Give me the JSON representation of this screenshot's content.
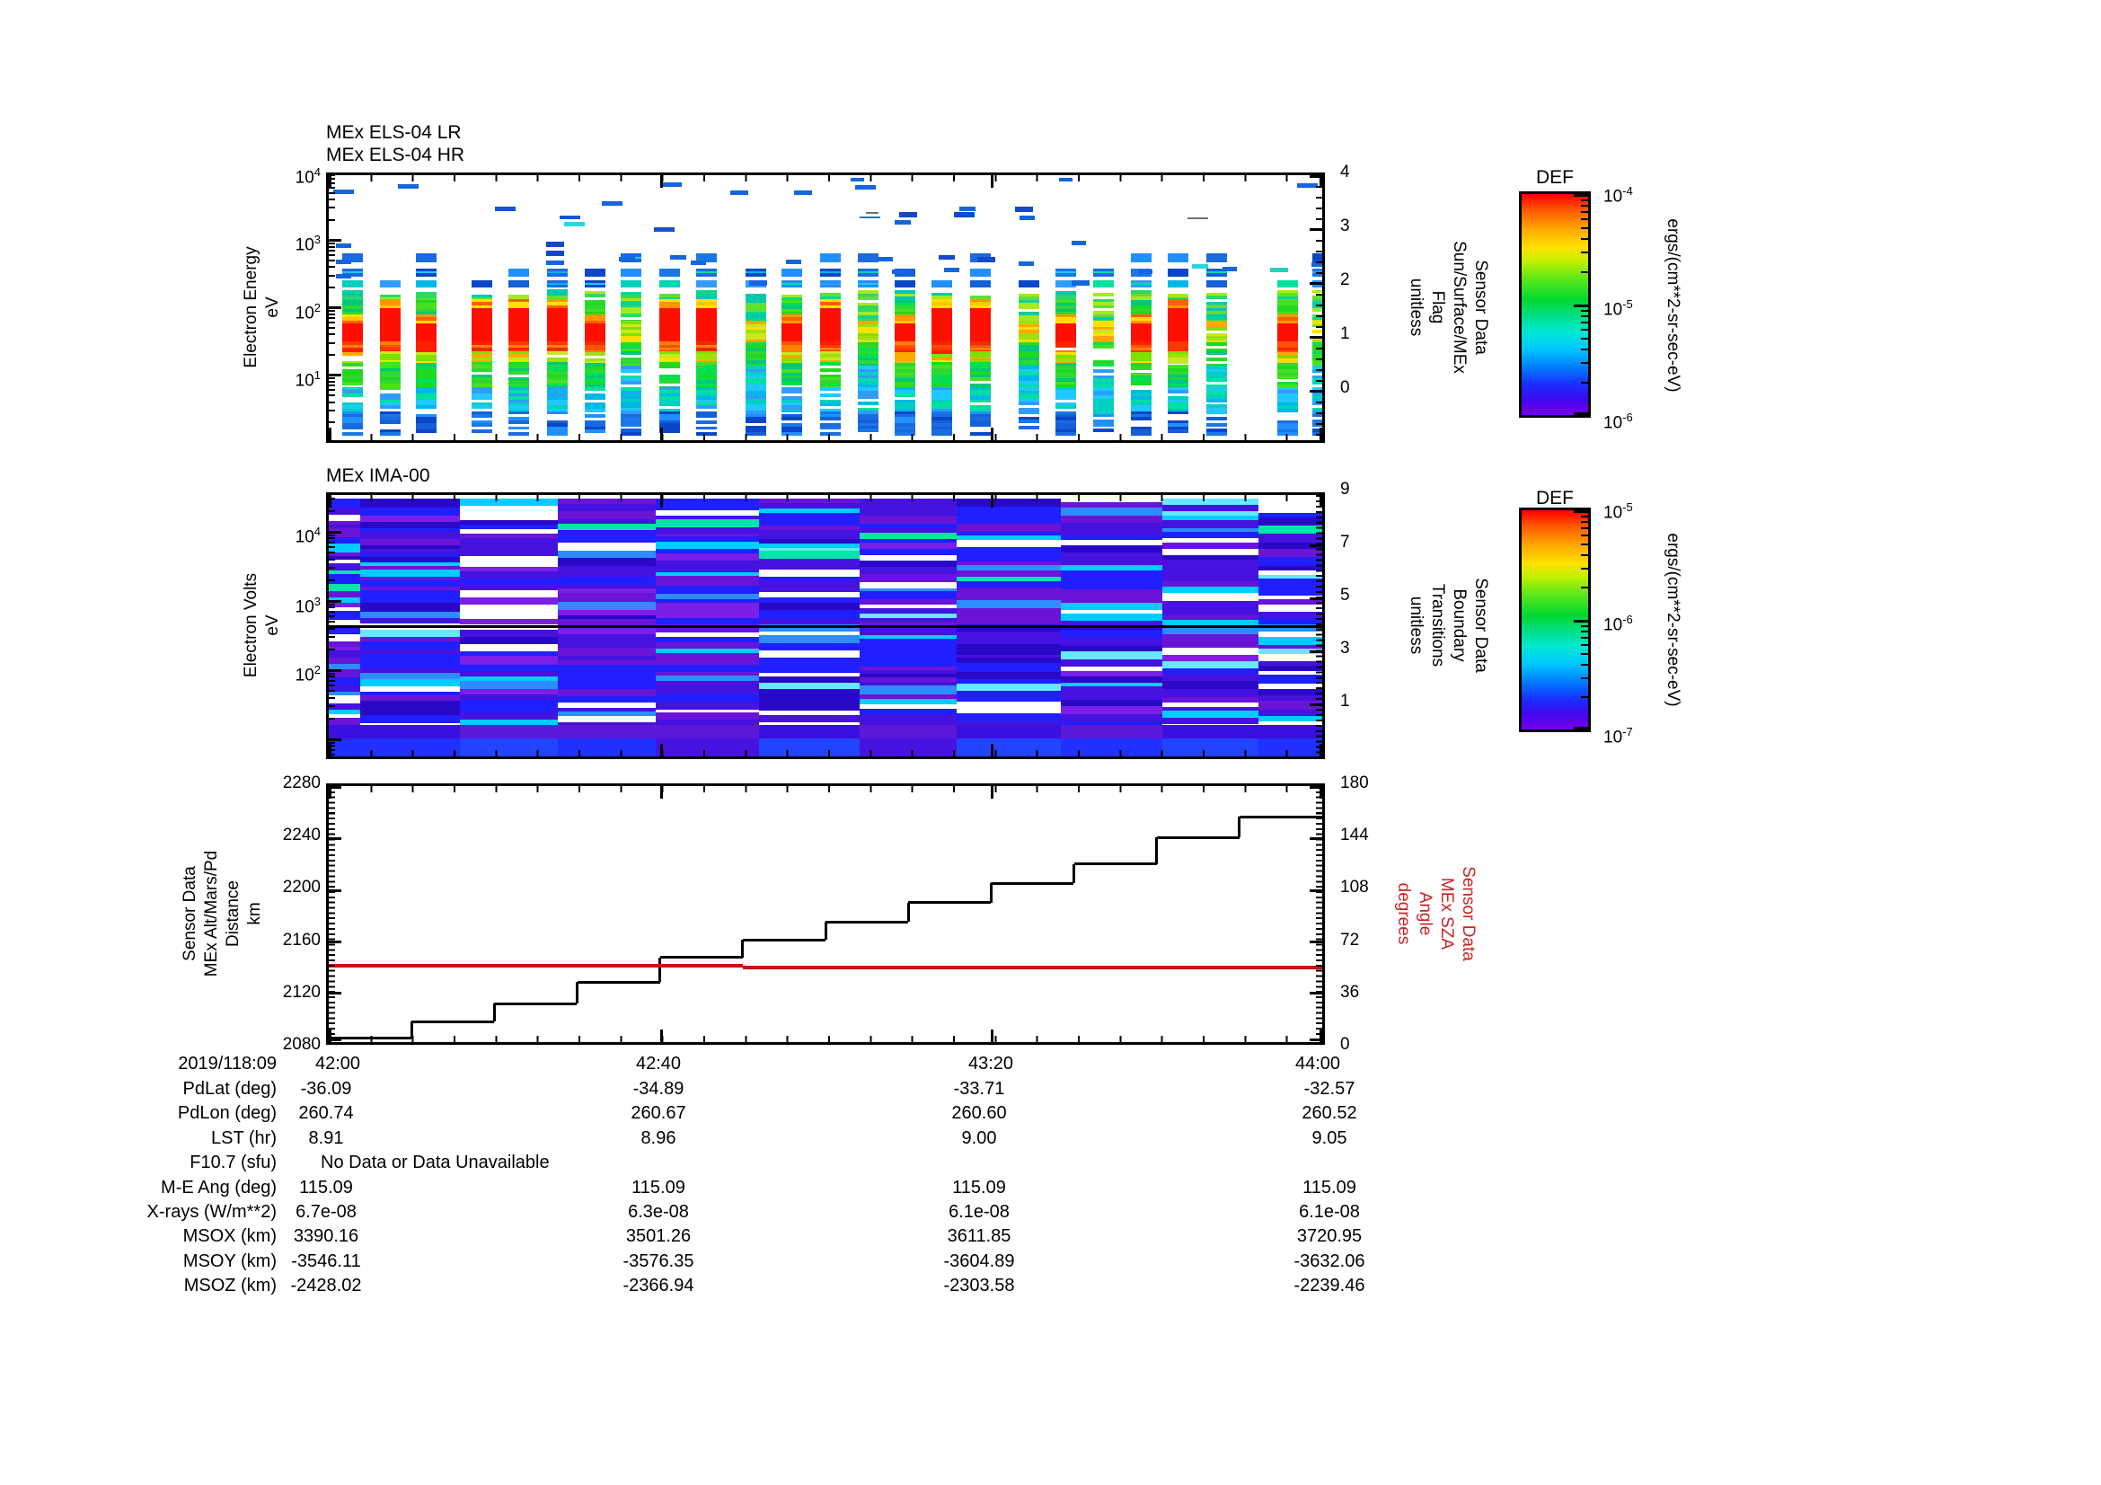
{
  "page": {
    "background": "#ffffff"
  },
  "panels": {
    "els": {
      "title_lr": "MEx ELS-04 LR",
      "title_hr": "MEx ELS-04 HR",
      "ylabel_lines": [
        "Electron Energy",
        "eV"
      ],
      "yticks": [
        "10^4",
        "10^3",
        "10^2",
        "10^1"
      ],
      "right_axis": {
        "ticks": [
          "4",
          "3",
          "2",
          "1",
          "0"
        ],
        "label_lines": [
          "Sensor Data",
          "Sun/Surface/MEx",
          "Flag",
          "unitless"
        ]
      }
    },
    "ima": {
      "title": "MEx IMA-00",
      "ylabel_lines": [
        "Electron Volts",
        "eV"
      ],
      "yticks": [
        "10^4",
        "10^3",
        "10^2"
      ],
      "right_axis": {
        "ticks": [
          "9",
          "7",
          "5",
          "3",
          "1"
        ],
        "label_lines": [
          "Sensor Data",
          "Boundary",
          "Transitions",
          "unitless"
        ]
      },
      "divider_y": 0.498
    },
    "line": {
      "left_axis": {
        "ticks": [
          "2280",
          "2240",
          "2200",
          "2160",
          "2120",
          "2080"
        ],
        "label_lines": [
          "Sensor Data",
          "MEx Alt/Mars/Pd",
          "Distance",
          "km"
        ]
      },
      "right_axis": {
        "ticks": [
          "180",
          "144",
          "108",
          "72",
          "36",
          "0"
        ],
        "label_lines": [
          "Sensor Data",
          "MEx SZA",
          "Angle",
          "degrees"
        ],
        "color": "#cc2222"
      },
      "xticks": [
        "42:00",
        "42:40",
        "43:20",
        "44:00"
      ]
    }
  },
  "colorbars": [
    {
      "title": "DEF",
      "ticks": [
        "10^-4",
        "10^-5",
        "10^-6"
      ],
      "units": "ergs/(cm**2-sr-sec-eV)"
    },
    {
      "title": "DEF",
      "ticks": [
        "10^-5",
        "10^-6",
        "10^-7"
      ],
      "units": "ergs/(cm**2-sr-sec-eV)"
    }
  ],
  "table": {
    "date_label": "2019/118:09",
    "times": [
      "42:00",
      "42:40",
      "43:20",
      "44:00"
    ],
    "no_data_text": "No Data or Data Unavailable",
    "rows": [
      {
        "label": "PdLat (deg)",
        "values": [
          "-36.09",
          "-34.89",
          "-33.71",
          "-32.57"
        ]
      },
      {
        "label": "PdLon (deg)",
        "values": [
          "260.74",
          "260.67",
          "260.60",
          "260.52"
        ]
      },
      {
        "label": "LST (hr)",
        "values": [
          "8.91",
          "8.96",
          "9.00",
          "9.05"
        ]
      },
      {
        "label": "F10.7 (sfu)",
        "values": [
          "",
          "",
          "",
          ""
        ],
        "no_data": true
      },
      {
        "label": "M-E Ang (deg)",
        "values": [
          "115.09",
          "115.09",
          "115.09",
          "115.09"
        ]
      },
      {
        "label": "X-rays (W/m**2)",
        "values": [
          "6.7e-08",
          "6.3e-08",
          "6.1e-08",
          "6.1e-08"
        ]
      },
      {
        "label": "MSOX (km)",
        "values": [
          "3390.16",
          "3501.26",
          "3611.85",
          "3720.95"
        ]
      },
      {
        "label": "MSOY (km)",
        "values": [
          "-3546.11",
          "-3576.35",
          "-3604.89",
          "-3632.06"
        ]
      },
      {
        "label": "MSOZ (km)",
        "values": [
          "-2428.02",
          "-2366.94",
          "-2303.58",
          "-2239.46"
        ]
      }
    ]
  },
  "chart_data": [
    {
      "type": "heatmap",
      "title": "MEx ELS-04 LR / MEx ELS-04 HR",
      "xlabel": "time (2019/118 09:42:00 - 09:44:00)",
      "ylabel": "Electron Energy (eV)",
      "ylim": [
        1,
        10000
      ],
      "yscale": "log",
      "right_axis": {
        "label": "Sensor Data Sun/Surface/MEx Flag (unitless)",
        "ylim": [
          -1,
          4
        ]
      },
      "zlabel": "DEF ergs/(cm**2-sr-sec-eV)",
      "zlim": [
        1e-06,
        0.0001
      ],
      "description": "Burst columns ~30-150 eV reaching ~1e-4 (red), banded green/cyan/blue flux 2-200 eV, sparse blue points 200-8000 eV"
    },
    {
      "type": "heatmap",
      "title": "MEx IMA-00",
      "ylabel": "Electron Volts (eV)",
      "ylim": [
        5,
        40000
      ],
      "yscale": "log",
      "right_axis": {
        "label": "Sensor Data Boundary Transitions (unitless)",
        "ylim": [
          -1,
          9
        ]
      },
      "zlabel": "DEF ergs/(cm**2-sr-sec-eV)",
      "zlim": [
        1e-07,
        1e-05
      ],
      "description": "Dense blue/violet striped mosaic with cyan rows and white gaps; solid black trace across ~460 eV"
    },
    {
      "type": "line",
      "x_axis": {
        "ticks": [
          "42:00",
          "42:40",
          "43:20",
          "44:00"
        ],
        "minutes_span": 120,
        "date": "2019/118:09"
      },
      "left_ylim": [
        2080,
        2280
      ],
      "right_ylim": [
        0,
        180
      ],
      "series": [
        {
          "name": "MEx Alt/Mars/Pd Distance (km)",
          "color": "#000000",
          "style": "step",
          "t_min": [
            0,
            10,
            20,
            30,
            40,
            50,
            60,
            70,
            80,
            90,
            100,
            110,
            120
          ],
          "alt_km": [
            2083,
            2096,
            2110,
            2127,
            2146,
            2160,
            2174,
            2189,
            2204,
            2219,
            2240,
            2256
          ]
        },
        {
          "name": "MEx SZA Angle (degrees)",
          "color": "#cc1111",
          "style": "step",
          "t_min": [
            0,
            50,
            120
          ],
          "sza_deg": [
            54.0,
            52.2
          ]
        }
      ]
    }
  ],
  "texture": {
    "els_bar_width": 0.0207,
    "els_bars": [
      {
        "x": 0.024,
        "p": "M",
        "s": 1
      },
      {
        "x": 0.062,
        "p": "R",
        "s": 2
      },
      {
        "x": 0.098,
        "p": "M",
        "s": 3
      },
      {
        "x": 0.153,
        "p": "R",
        "s": 4
      },
      {
        "x": 0.19,
        "p": "R",
        "s": 5
      },
      {
        "x": 0.229,
        "p": "R",
        "s": 6
      },
      {
        "x": 0.267,
        "p": "M",
        "s": 7
      },
      {
        "x": 0.303,
        "p": "G",
        "s": 8
      },
      {
        "x": 0.341,
        "p": "R",
        "s": 9
      },
      {
        "x": 0.378,
        "p": "R",
        "s": 10
      },
      {
        "x": 0.428,
        "p": "G",
        "s": 11
      },
      {
        "x": 0.464,
        "p": "M",
        "s": 12
      },
      {
        "x": 0.502,
        "p": "R",
        "s": 13
      },
      {
        "x": 0.54,
        "p": "G",
        "s": 14
      },
      {
        "x": 0.577,
        "p": "M",
        "s": 15
      },
      {
        "x": 0.614,
        "p": "R",
        "s": 16
      },
      {
        "x": 0.652,
        "p": "R",
        "s": 17
      },
      {
        "x": 0.701,
        "p": "G",
        "s": 18
      },
      {
        "x": 0.738,
        "p": "M",
        "s": 19
      },
      {
        "x": 0.776,
        "p": "G",
        "s": 20
      },
      {
        "x": 0.813,
        "p": "M",
        "s": 21
      },
      {
        "x": 0.85,
        "p": "R",
        "s": 22
      },
      {
        "x": 0.889,
        "p": "G",
        "s": 23
      },
      {
        "x": 0.96,
        "p": "M",
        "s": 24
      },
      {
        "x": 0.995,
        "p": "G",
        "s": 25
      }
    ],
    "els_dashes": [
      [
        0.015,
        0.055,
        0.021,
        5,
        "#1565dd"
      ],
      [
        0.08,
        0.033,
        0.021,
        5,
        "#1565dd"
      ],
      [
        0.178,
        0.12,
        0.021,
        5,
        "#1b4fd0"
      ],
      [
        0.285,
        0.098,
        0.021,
        5,
        "#1565dd"
      ],
      [
        0.243,
        0.152,
        0.021,
        4,
        "#1b4fd0"
      ],
      [
        0.247,
        0.176,
        0.021,
        5,
        "#28d8d8"
      ],
      [
        0.345,
        0.028,
        0.021,
        5,
        "#1565dd"
      ],
      [
        0.338,
        0.195,
        0.021,
        5,
        "#1b4fd0"
      ],
      [
        0.413,
        0.058,
        0.018,
        5,
        "#1565dd"
      ],
      [
        0.477,
        0.058,
        0.018,
        5,
        "#1565dd"
      ],
      [
        0.54,
        0.038,
        0.021,
        5,
        "#1565dd"
      ],
      [
        0.545,
        0.155,
        0.021,
        2,
        "#2a6be0"
      ],
      [
        0.583,
        0.14,
        0.018,
        6,
        "#1348cc"
      ],
      [
        0.578,
        0.168,
        0.016,
        5,
        "#1565dd"
      ],
      [
        0.64,
        0.14,
        0.021,
        6,
        "#1348cc"
      ],
      [
        0.643,
        0.118,
        0.016,
        5,
        "#1565dd"
      ],
      [
        0.7,
        0.118,
        0.018,
        6,
        "#1348cc"
      ],
      [
        0.703,
        0.152,
        0.016,
        5,
        "#1565dd"
      ],
      [
        0.755,
        0.248,
        0.014,
        5,
        "#1565dd"
      ],
      [
        0.875,
        0.158,
        0.021,
        2,
        "#707070"
      ],
      [
        0.985,
        0.03,
        0.021,
        5,
        "#1565dd"
      ],
      [
        0.532,
        0.01,
        0.014,
        4,
        "#1565dd"
      ],
      [
        0.742,
        0.01,
        0.014,
        4,
        "#1565dd"
      ],
      [
        0.547,
        0.14,
        0.012,
        2,
        "#707070"
      ],
      [
        0.015,
        0.258,
        0.016,
        5,
        "#1565dd"
      ],
      [
        0.015,
        0.318,
        0.016,
        5,
        "#1565dd"
      ],
      [
        0.015,
        0.372,
        0.016,
        5,
        "#1565dd"
      ],
      [
        0.228,
        0.25,
        0.018,
        6,
        "#1348cc"
      ],
      [
        0.228,
        0.285,
        0.018,
        6,
        "#1348cc"
      ],
      [
        0.228,
        0.322,
        0.018,
        5,
        "#1565dd"
      ],
      [
        0.3,
        0.31,
        0.016,
        5,
        "#1565dd"
      ],
      [
        0.352,
        0.3,
        0.016,
        5,
        "#1565dd"
      ],
      [
        0.372,
        0.322,
        0.016,
        5,
        "#1565dd"
      ],
      [
        0.432,
        0.398,
        0.018,
        6,
        "#1565dd"
      ],
      [
        0.468,
        0.32,
        0.016,
        5,
        "#1565dd"
      ],
      [
        0.56,
        0.31,
        0.016,
        5,
        "#1565dd"
      ],
      [
        0.575,
        0.355,
        0.016,
        5,
        "#1565dd"
      ],
      [
        0.622,
        0.3,
        0.016,
        5,
        "#1348cc"
      ],
      [
        0.627,
        0.35,
        0.016,
        5,
        "#1565dd"
      ],
      [
        0.662,
        0.31,
        0.018,
        6,
        "#1348cc"
      ],
      [
        0.702,
        0.325,
        0.016,
        5,
        "#1565dd"
      ],
      [
        0.757,
        0.398,
        0.018,
        6,
        "#1565dd"
      ],
      [
        0.822,
        0.355,
        0.014,
        5,
        "#1565dd"
      ],
      [
        0.877,
        0.335,
        0.016,
        5,
        "#28d8d8"
      ],
      [
        0.907,
        0.345,
        0.014,
        5,
        "#1565dd"
      ],
      [
        0.957,
        0.35,
        0.018,
        5,
        "#28d0c0"
      ],
      [
        0.997,
        0.33,
        0.016,
        5,
        "#1565dd"
      ]
    ],
    "ima_block_edges": [
      0,
      0.032,
      0.132,
      0.231,
      0.329,
      0.433,
      0.534,
      0.632,
      0.737,
      0.839,
      0.936,
      1.0
    ],
    "ima_seeds": [
      31,
      12,
      13,
      14,
      15,
      16,
      17,
      18,
      19,
      20,
      21
    ]
  }
}
